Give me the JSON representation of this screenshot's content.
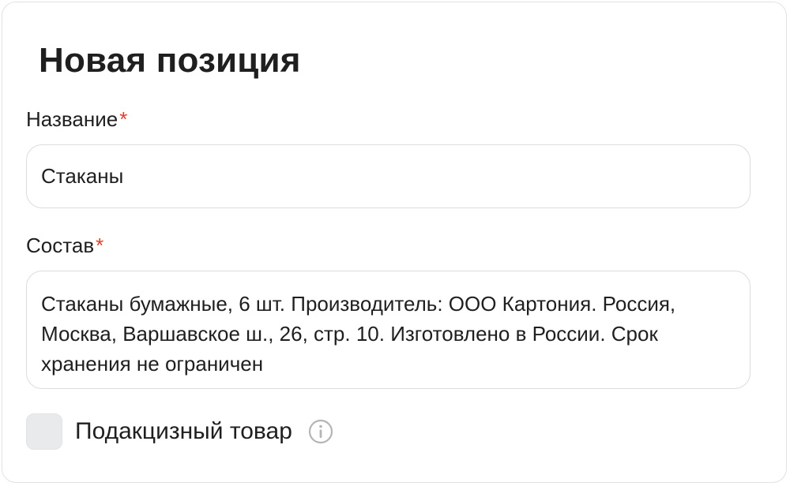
{
  "form": {
    "title": "Новая позиция",
    "name_field": {
      "label": "Название",
      "required_mark": "*",
      "value": "Стаканы"
    },
    "composition_field": {
      "label": "Состав",
      "required_mark": "*",
      "value": "Стаканы бумажные, 6 шт. Производитель: ООО Картония. Россия, Москва, Варшавское ш., 26, стр. 10. Изготовлено в России. Срок хранения не ограничен"
    },
    "excise_checkbox": {
      "label": "Подакцизный товар",
      "checked": false,
      "info_icon": "info-icon"
    }
  },
  "colors": {
    "required": "#e0402a",
    "text": "#1f1f1f",
    "border": "#dcdcdc",
    "checkbox_bg": "#e9eaeb",
    "info_icon": "#b5b5b5"
  }
}
